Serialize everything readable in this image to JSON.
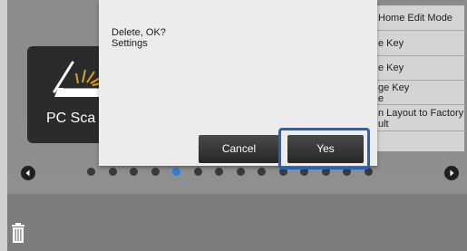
{
  "home": {
    "tile_label": "PC Sca"
  },
  "side_menu": {
    "items": [
      {
        "label": "Home Edit Mode"
      },
      {
        "label": "e Key"
      },
      {
        "label": "e Key"
      },
      {
        "label_line1": "ge Key",
        "label_line2": "e"
      },
      {
        "label_line1": "n Layout to Factory",
        "label_line2": "ult"
      }
    ]
  },
  "pager": {
    "dot_count": 14,
    "active_index": 4,
    "active_color": "#2f7fd6"
  },
  "dialog": {
    "message_line1": "Delete, OK?",
    "message_line2": "Settings",
    "cancel_label": "Cancel",
    "yes_label": "Yes",
    "focus_color": "#2a61b8"
  },
  "icons": {
    "scan": "scanner-icon",
    "trash": "trash-icon",
    "left": "chevron-left-icon",
    "right": "chevron-right-icon"
  }
}
